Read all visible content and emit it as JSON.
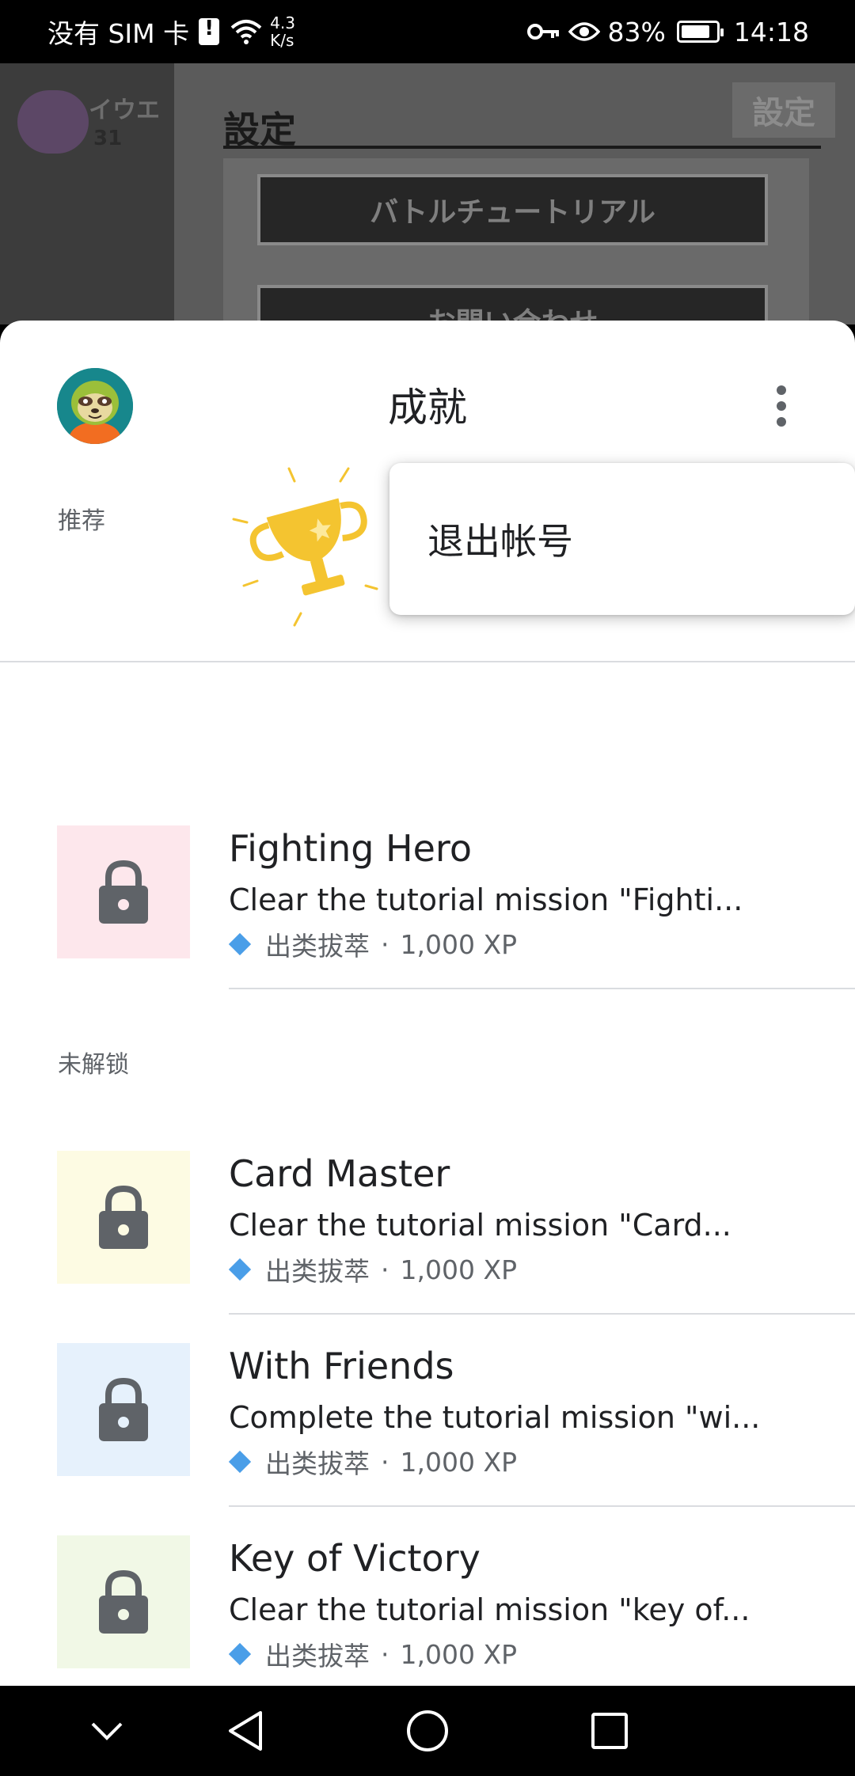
{
  "status_bar": {
    "carrier": "没有 SIM 卡",
    "net_speed_value": "4.3",
    "net_speed_unit": "K/s",
    "battery": "83%",
    "battery_level": 0.83,
    "time": "14:18"
  },
  "background_game": {
    "player_name": "イウエ",
    "level": "31",
    "settings_title": "設定",
    "settings_button": "設定",
    "menu_buttons": [
      "バトルチュートリアル",
      "お問い合わせ"
    ]
  },
  "sheet": {
    "title": "成就",
    "popup_menu": {
      "items": [
        "退出帐号"
      ]
    },
    "sections": [
      {
        "label": "推荐",
        "items": [
          {
            "name": "Fighting Hero",
            "description": "Clear the tutorial mission \"Fighti...",
            "rarity": "出类拔萃",
            "separator": "·",
            "xp": "1,000 XP",
            "thumb_color": "#fde7ec"
          }
        ]
      },
      {
        "label": "未解锁",
        "items": [
          {
            "name": "Card Master",
            "description": "Clear the tutorial mission \"Card...",
            "rarity": "出类拔萃",
            "separator": "·",
            "xp": "1,000 XP",
            "thumb_color": "#fdfbe3"
          },
          {
            "name": "With Friends",
            "description": "Complete the tutorial mission \"wi...",
            "rarity": "出类拔萃",
            "separator": "·",
            "xp": "1,000 XP",
            "thumb_color": "#e6f1fc"
          },
          {
            "name": "Key of Victory",
            "description": "Clear the tutorial mission \"key of...",
            "rarity": "出类拔萃",
            "separator": "·",
            "xp": "1,000 XP",
            "thumb_color": "#f1f8e6"
          }
        ]
      }
    ]
  },
  "icons": {
    "lock": "lock-icon",
    "more": "more-vert-icon",
    "trophy": "trophy-icon",
    "diamond": "diamond-icon"
  },
  "colors": {
    "accent_diamond": "#4a9ee8",
    "lock": "#5f6368",
    "trophy": "#f4c430"
  }
}
